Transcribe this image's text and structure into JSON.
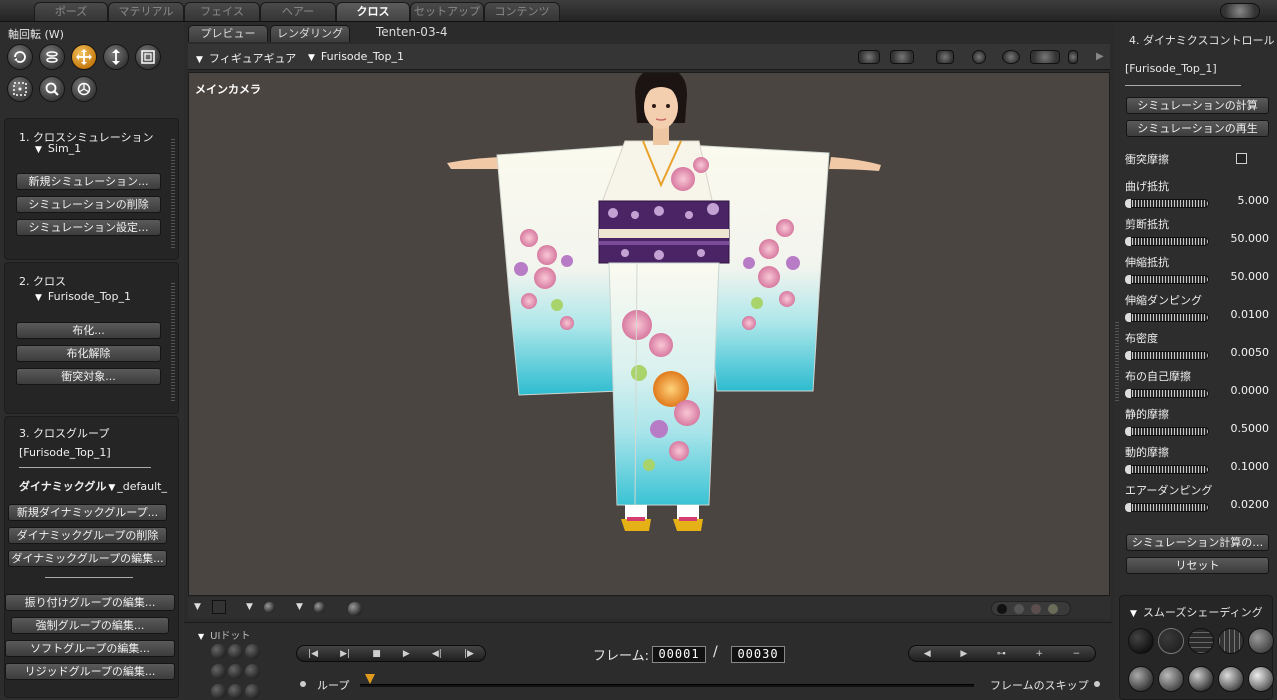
{
  "top_tabs": [
    {
      "label": "ポーズ",
      "active": false
    },
    {
      "label": "マテリアル",
      "active": false
    },
    {
      "label": "フェイス",
      "active": false
    },
    {
      "label": "ヘアー",
      "active": false
    },
    {
      "label": "クロス",
      "active": true
    },
    {
      "label": "セットアップ",
      "active": false
    },
    {
      "label": "コンテンツ",
      "active": false
    }
  ],
  "left": {
    "axis_label": "軸回転 (W)",
    "tools": [
      "rotate-icon",
      "twist-icon",
      "translate-icon",
      "scale-icon",
      "taper-icon",
      "chain-break-icon",
      "zoom-icon",
      "direct-manipulation-icon"
    ],
    "s1": {
      "title": "1. クロスシミュレーション",
      "dropdown": "Sim_1",
      "buttons": [
        "新規シミュレーション...",
        "シミュレーションの削除",
        "シミュレーション設定..."
      ]
    },
    "s2": {
      "title": "2. クロス",
      "dropdown": "Furisode_Top_1",
      "buttons": [
        "布化...",
        "布化解除",
        "衝突対象..."
      ]
    },
    "s3": {
      "title": "3. クロスグループ",
      "object": "[Furisode_Top_1]",
      "dyn_label": "ダイナミックグル",
      "dyn_value": "_default_",
      "buttons": [
        "新規ダイナミックグループ...",
        "ダイナミックグループの削除",
        "ダイナミックグループの編集..."
      ],
      "buttons2": [
        "振り付けグループの編集...",
        "強制グループの編集...",
        "ソフトグループの編集...",
        "リジッドグループの編集..."
      ]
    }
  },
  "center": {
    "tabs": [
      "プレビュー",
      "レンダリング"
    ],
    "doc_title": "Tenten-03-4",
    "figure_menu": "フィギュアギュア",
    "figure_name": "Furisode_Top_1",
    "camera": "メインカメラ"
  },
  "right": {
    "title": "4. ダイナミクスコントロール",
    "object": "[Furisode_Top_1]",
    "btn_calc": "シミュレーションの計算",
    "btn_play": "シミュレーションの再生",
    "collision_friction": "衝突摩擦",
    "params": [
      {
        "label": "曲げ抵抗",
        "value": "5.000"
      },
      {
        "label": "剪断抵抗",
        "value": "50.000"
      },
      {
        "label": "伸縮抵抗",
        "value": "50.000"
      },
      {
        "label": "伸縮ダンピング",
        "value": "0.0100"
      },
      {
        "label": "布密度",
        "value": "0.0050"
      },
      {
        "label": "布の自己摩擦",
        "value": "0.0000"
      },
      {
        "label": "静的摩擦",
        "value": "0.5000"
      },
      {
        "label": "動的摩擦",
        "value": "0.1000"
      },
      {
        "label": "エアーダンピング",
        "value": "0.0200"
      }
    ],
    "btn_calc2": "シミュレーション計算の…",
    "btn_reset": "リセット",
    "smooth_shading": "スムーズシェーディング"
  },
  "bottom": {
    "ui_dots": "UIドット",
    "frame_label": "フレーム:",
    "frame_current": "00001",
    "frame_sep": "/",
    "frame_total": "00030",
    "loop": "ループ",
    "skip_frames": "フレームのスキップ"
  },
  "colors": {
    "accent": "#e09a1c",
    "kimono_cyan": "#37c6d6",
    "obi_purple": "#4b2466",
    "viewport_bg": "#4b4542"
  }
}
